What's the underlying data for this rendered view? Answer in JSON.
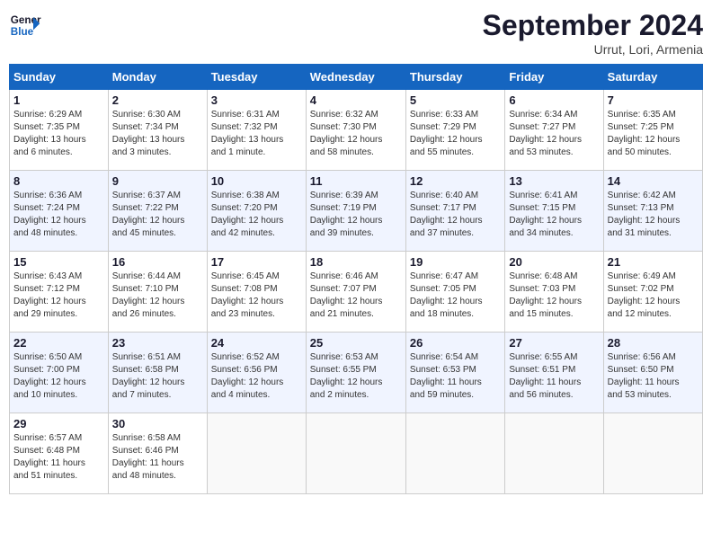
{
  "header": {
    "logo_line1": "General",
    "logo_line2": "Blue",
    "month_title": "September 2024",
    "location": "Urrut, Lori, Armenia"
  },
  "columns": [
    "Sunday",
    "Monday",
    "Tuesday",
    "Wednesday",
    "Thursday",
    "Friday",
    "Saturday"
  ],
  "weeks": [
    [
      {
        "day": "1",
        "info": "Sunrise: 6:29 AM\nSunset: 7:35 PM\nDaylight: 13 hours\nand 6 minutes."
      },
      {
        "day": "2",
        "info": "Sunrise: 6:30 AM\nSunset: 7:34 PM\nDaylight: 13 hours\nand 3 minutes."
      },
      {
        "day": "3",
        "info": "Sunrise: 6:31 AM\nSunset: 7:32 PM\nDaylight: 13 hours\nand 1 minute."
      },
      {
        "day": "4",
        "info": "Sunrise: 6:32 AM\nSunset: 7:30 PM\nDaylight: 12 hours\nand 58 minutes."
      },
      {
        "day": "5",
        "info": "Sunrise: 6:33 AM\nSunset: 7:29 PM\nDaylight: 12 hours\nand 55 minutes."
      },
      {
        "day": "6",
        "info": "Sunrise: 6:34 AM\nSunset: 7:27 PM\nDaylight: 12 hours\nand 53 minutes."
      },
      {
        "day": "7",
        "info": "Sunrise: 6:35 AM\nSunset: 7:25 PM\nDaylight: 12 hours\nand 50 minutes."
      }
    ],
    [
      {
        "day": "8",
        "info": "Sunrise: 6:36 AM\nSunset: 7:24 PM\nDaylight: 12 hours\nand 48 minutes."
      },
      {
        "day": "9",
        "info": "Sunrise: 6:37 AM\nSunset: 7:22 PM\nDaylight: 12 hours\nand 45 minutes."
      },
      {
        "day": "10",
        "info": "Sunrise: 6:38 AM\nSunset: 7:20 PM\nDaylight: 12 hours\nand 42 minutes."
      },
      {
        "day": "11",
        "info": "Sunrise: 6:39 AM\nSunset: 7:19 PM\nDaylight: 12 hours\nand 39 minutes."
      },
      {
        "day": "12",
        "info": "Sunrise: 6:40 AM\nSunset: 7:17 PM\nDaylight: 12 hours\nand 37 minutes."
      },
      {
        "day": "13",
        "info": "Sunrise: 6:41 AM\nSunset: 7:15 PM\nDaylight: 12 hours\nand 34 minutes."
      },
      {
        "day": "14",
        "info": "Sunrise: 6:42 AM\nSunset: 7:13 PM\nDaylight: 12 hours\nand 31 minutes."
      }
    ],
    [
      {
        "day": "15",
        "info": "Sunrise: 6:43 AM\nSunset: 7:12 PM\nDaylight: 12 hours\nand 29 minutes."
      },
      {
        "day": "16",
        "info": "Sunrise: 6:44 AM\nSunset: 7:10 PM\nDaylight: 12 hours\nand 26 minutes."
      },
      {
        "day": "17",
        "info": "Sunrise: 6:45 AM\nSunset: 7:08 PM\nDaylight: 12 hours\nand 23 minutes."
      },
      {
        "day": "18",
        "info": "Sunrise: 6:46 AM\nSunset: 7:07 PM\nDaylight: 12 hours\nand 21 minutes."
      },
      {
        "day": "19",
        "info": "Sunrise: 6:47 AM\nSunset: 7:05 PM\nDaylight: 12 hours\nand 18 minutes."
      },
      {
        "day": "20",
        "info": "Sunrise: 6:48 AM\nSunset: 7:03 PM\nDaylight: 12 hours\nand 15 minutes."
      },
      {
        "day": "21",
        "info": "Sunrise: 6:49 AM\nSunset: 7:02 PM\nDaylight: 12 hours\nand 12 minutes."
      }
    ],
    [
      {
        "day": "22",
        "info": "Sunrise: 6:50 AM\nSunset: 7:00 PM\nDaylight: 12 hours\nand 10 minutes."
      },
      {
        "day": "23",
        "info": "Sunrise: 6:51 AM\nSunset: 6:58 PM\nDaylight: 12 hours\nand 7 minutes."
      },
      {
        "day": "24",
        "info": "Sunrise: 6:52 AM\nSunset: 6:56 PM\nDaylight: 12 hours\nand 4 minutes."
      },
      {
        "day": "25",
        "info": "Sunrise: 6:53 AM\nSunset: 6:55 PM\nDaylight: 12 hours\nand 2 minutes."
      },
      {
        "day": "26",
        "info": "Sunrise: 6:54 AM\nSunset: 6:53 PM\nDaylight: 11 hours\nand 59 minutes."
      },
      {
        "day": "27",
        "info": "Sunrise: 6:55 AM\nSunset: 6:51 PM\nDaylight: 11 hours\nand 56 minutes."
      },
      {
        "day": "28",
        "info": "Sunrise: 6:56 AM\nSunset: 6:50 PM\nDaylight: 11 hours\nand 53 minutes."
      }
    ],
    [
      {
        "day": "29",
        "info": "Sunrise: 6:57 AM\nSunset: 6:48 PM\nDaylight: 11 hours\nand 51 minutes."
      },
      {
        "day": "30",
        "info": "Sunrise: 6:58 AM\nSunset: 6:46 PM\nDaylight: 11 hours\nand 48 minutes."
      },
      {
        "day": "",
        "info": ""
      },
      {
        "day": "",
        "info": ""
      },
      {
        "day": "",
        "info": ""
      },
      {
        "day": "",
        "info": ""
      },
      {
        "day": "",
        "info": ""
      }
    ]
  ]
}
